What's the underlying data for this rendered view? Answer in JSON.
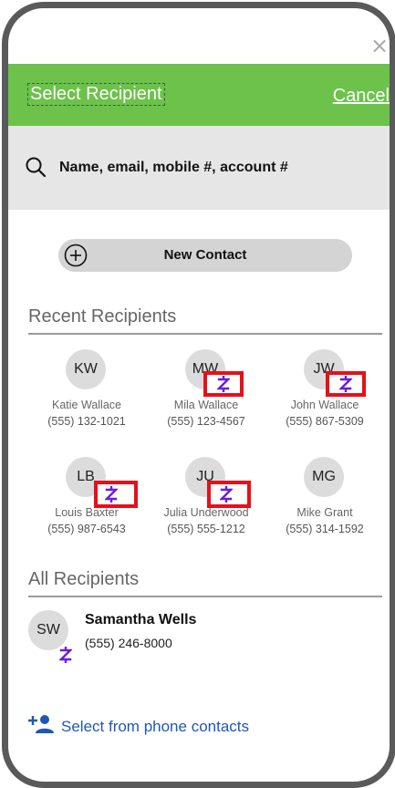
{
  "header": {
    "title": "Select Recipient",
    "cancel_label": "Cancel",
    "background": "#6cc24a"
  },
  "close_glyph": "×",
  "search": {
    "placeholder": "Name, email, mobile #, account #",
    "icon": "search-icon"
  },
  "new_contact": {
    "label": "New Contact",
    "icon": "plus-circle-icon"
  },
  "recent": {
    "title": "Recent Recipients",
    "items": [
      {
        "initials": "KW",
        "name": "Katie Wallace",
        "phone": "(555) 132-1021",
        "zelle": false
      },
      {
        "initials": "MW",
        "name": "Mila Wallace",
        "phone": "(555) 123-4567",
        "zelle": true
      },
      {
        "initials": "JW",
        "name": "John Wallace",
        "phone": "(555) 867-5309",
        "zelle": true
      },
      {
        "initials": "LB",
        "name": "Louis Baxter",
        "phone": "(555) 987-6543",
        "zelle": true
      },
      {
        "initials": "JU",
        "name": "Julia Underwood",
        "phone": "(555) 555-1212",
        "zelle": true
      },
      {
        "initials": "MG",
        "name": "Mike Grant",
        "phone": "(555) 314-1592",
        "zelle": false
      }
    ]
  },
  "all": {
    "title": "All Recipients",
    "items": [
      {
        "initials": "SW",
        "name": "Samantha Wells",
        "phone": "(555) 246-8000",
        "zelle": true
      }
    ]
  },
  "phone_contacts": {
    "label": "Select from phone contacts",
    "icon": "add-person-icon",
    "color": "#1f57b8"
  },
  "colors": {
    "zelle_purple": "#6d1ed4",
    "highlight_red": "#e5101a"
  }
}
